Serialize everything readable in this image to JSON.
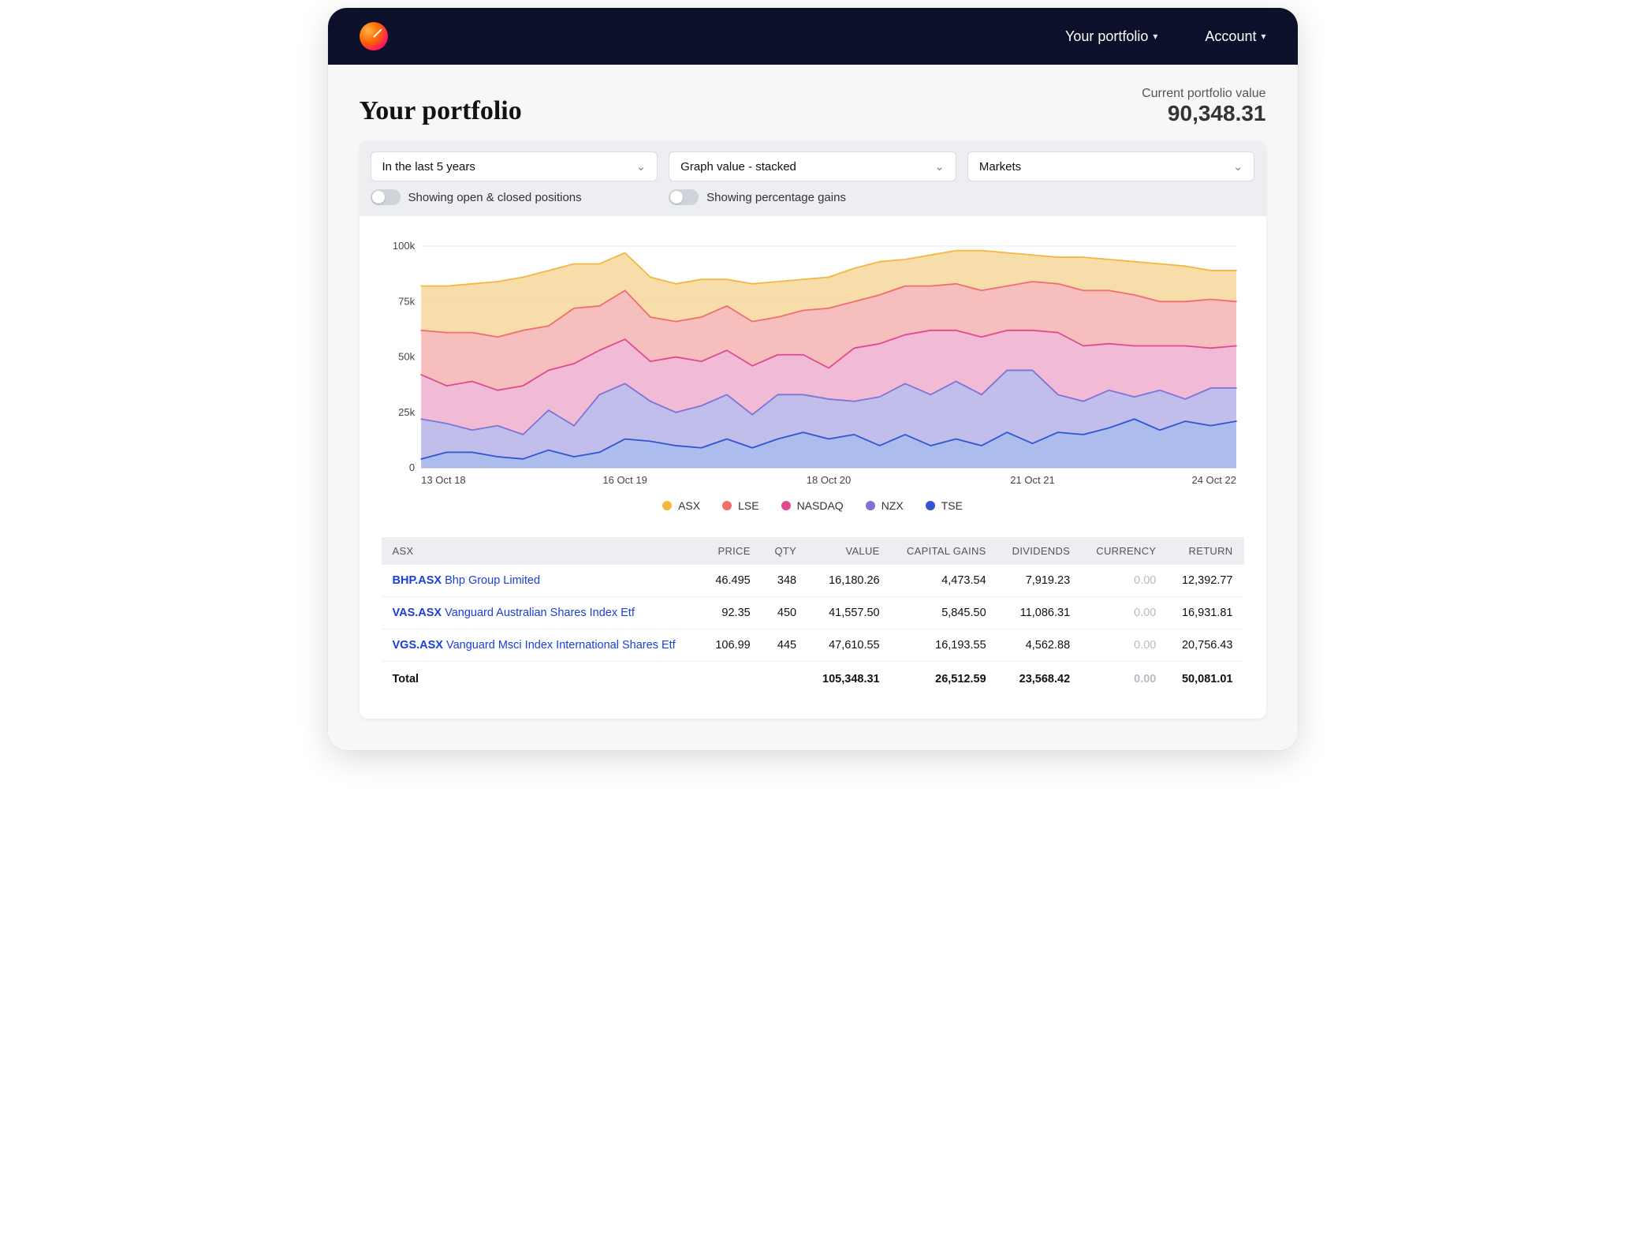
{
  "nav": {
    "portfolio_label": "Your portfolio",
    "account_label": "Account"
  },
  "header": {
    "title": "Your portfolio",
    "kpi_label": "Current portfolio value",
    "kpi_value": "90,348.31"
  },
  "controls": {
    "range_selected": "In the last 5 years",
    "graph_mode_selected": "Graph value - stacked",
    "grouping_selected": "Markets",
    "toggle_positions_label": "Showing open & closed positions",
    "toggle_percent_label": "Showing percentage gains"
  },
  "legend": {
    "items": [
      {
        "label": "ASX",
        "color": "#f4b740"
      },
      {
        "label": "LSE",
        "color": "#f26d6d"
      },
      {
        "label": "NASDAQ",
        "color": "#e04a8f"
      },
      {
        "label": "NZX",
        "color": "#7d74d9"
      },
      {
        "label": "TSE",
        "color": "#3054d3"
      }
    ]
  },
  "holdings": {
    "columns": [
      "ASX",
      "PRICE",
      "QTY",
      "VALUE",
      "CAPITAL GAINS",
      "DIVIDENDS",
      "CURRENCY",
      "RETURN"
    ],
    "rows": [
      {
        "ticker": "BHP.ASX",
        "name": "Bhp Group Limited",
        "price": "46.495",
        "qty": "348",
        "value": "16,180.26",
        "capital_gains": "4,473.54",
        "dividends": "7,919.23",
        "currency": "0.00",
        "return": "12,392.77"
      },
      {
        "ticker": "VAS.ASX",
        "name": "Vanguard Australian Shares Index Etf",
        "price": "92.35",
        "qty": "450",
        "value": "41,557.50",
        "capital_gains": "5,845.50",
        "dividends": "11,086.31",
        "currency": "0.00",
        "return": "16,931.81"
      },
      {
        "ticker": "VGS.ASX",
        "name": "Vanguard Msci Index International Shares Etf",
        "price": "106.99",
        "qty": "445",
        "value": "47,610.55",
        "capital_gains": "16,193.55",
        "dividends": "4,562.88",
        "currency": "0.00",
        "return": "20,756.43"
      }
    ],
    "total": {
      "label": "Total",
      "value": "105,348.31",
      "capital_gains": "26,512.59",
      "dividends": "23,568.42",
      "currency": "0.00",
      "return": "50,081.01"
    }
  },
  "chart_data": {
    "type": "area",
    "stacked": true,
    "title": "",
    "xlabel": "",
    "ylabel": "",
    "ylim": [
      0,
      100000
    ],
    "y_ticks": [
      0,
      25000,
      50000,
      75000,
      100000
    ],
    "y_tick_labels": [
      "0",
      "25k",
      "50k",
      "75k",
      "100k"
    ],
    "x_tick_labels": [
      "13 Oct 18",
      "16 Oct 19",
      "18 Oct 20",
      "21 Oct 21",
      "24 Oct 22"
    ],
    "x_tick_positions": [
      0,
      8,
      16,
      24,
      32
    ],
    "n_points": 33,
    "series": [
      {
        "name": "TSE",
        "color": "#3054d3",
        "fill": "#9eb2ea",
        "values": [
          4000,
          7000,
          7000,
          5000,
          4000,
          8000,
          5000,
          7000,
          13000,
          12000,
          10000,
          9000,
          13000,
          9000,
          13000,
          16000,
          13000,
          15000,
          10000,
          15000,
          10000,
          13000,
          10000,
          16000,
          11000,
          16000,
          15000,
          18000,
          22000,
          17000,
          21000,
          19000,
          21000
        ]
      },
      {
        "name": "NZX",
        "color": "#7d74d9",
        "fill": "#b7b3e8",
        "values": [
          18000,
          13000,
          10000,
          14000,
          11000,
          18000,
          14000,
          26000,
          25000,
          18000,
          15000,
          19000,
          20000,
          15000,
          20000,
          17000,
          18000,
          15000,
          22000,
          23000,
          23000,
          26000,
          23000,
          28000,
          33000,
          17000,
          15000,
          17000,
          10000,
          18000,
          10000,
          17000,
          15000
        ]
      },
      {
        "name": "NASDAQ",
        "color": "#e04a8f",
        "fill": "#efafce",
        "values": [
          20000,
          17000,
          22000,
          16000,
          22000,
          18000,
          28000,
          20000,
          20000,
          18000,
          25000,
          20000,
          20000,
          22000,
          18000,
          18000,
          14000,
          24000,
          24000,
          22000,
          29000,
          23000,
          26000,
          18000,
          18000,
          28000,
          25000,
          21000,
          23000,
          20000,
          24000,
          18000,
          19000
        ]
      },
      {
        "name": "LSE",
        "color": "#f26d6d",
        "fill": "#f6b3b3",
        "values": [
          20000,
          24000,
          22000,
          24000,
          25000,
          20000,
          25000,
          20000,
          22000,
          20000,
          16000,
          20000,
          20000,
          20000,
          17000,
          20000,
          27000,
          21000,
          22000,
          22000,
          20000,
          21000,
          21000,
          20000,
          22000,
          22000,
          25000,
          24000,
          23000,
          20000,
          20000,
          22000,
          20000
        ]
      },
      {
        "name": "ASX",
        "color": "#f4b740",
        "fill": "#f5d79a",
        "values": [
          20000,
          21000,
          22000,
          25000,
          24000,
          25000,
          20000,
          19000,
          17000,
          18000,
          17000,
          17000,
          12000,
          17000,
          16000,
          14000,
          14000,
          15000,
          15000,
          12000,
          14000,
          15000,
          18000,
          15000,
          12000,
          12000,
          15000,
          14000,
          15000,
          17000,
          16000,
          13000,
          14000
        ]
      }
    ]
  }
}
